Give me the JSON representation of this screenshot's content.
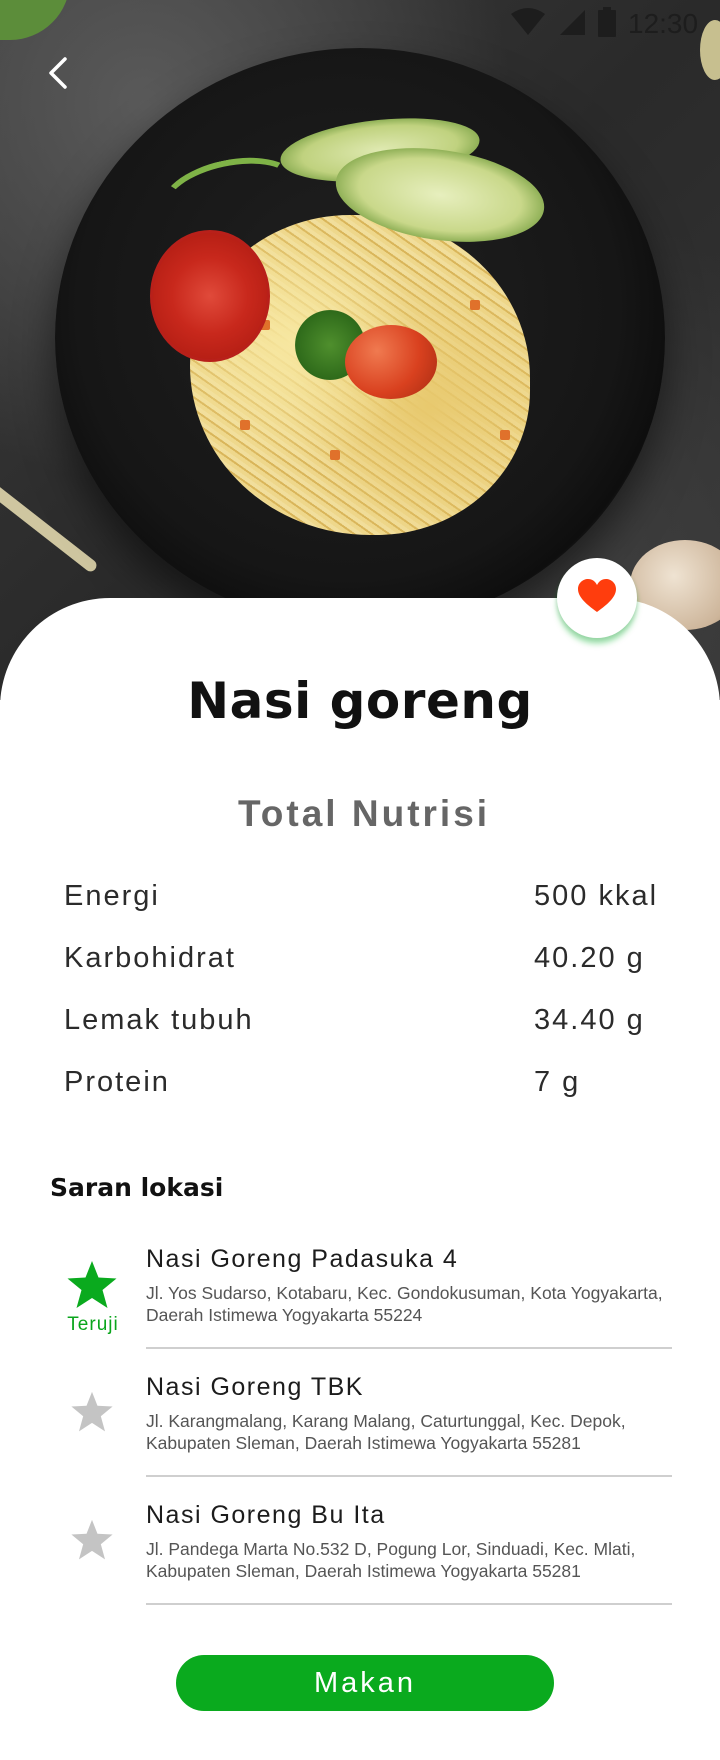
{
  "status_bar": {
    "time": "12:30"
  },
  "header": {
    "back_icon": "chevron-left-icon"
  },
  "hero": {
    "image": "nasi-goreng-photo"
  },
  "favorite": {
    "icon": "heart-icon",
    "color": "#ff3d0d"
  },
  "dish": {
    "title": "Nasi goreng"
  },
  "nutrition": {
    "heading": "Total Nutrisi",
    "rows": [
      {
        "label": "Energi",
        "value": "500 kkal"
      },
      {
        "label": "Karbohidrat",
        "value": "40.20 g"
      },
      {
        "label": "Lemak tubuh",
        "value": "34.40 g"
      },
      {
        "label": "Protein",
        "value": "7 g"
      }
    ]
  },
  "locations": {
    "title": "Saran lokasi",
    "items": [
      {
        "name": "Nasi Goreng Padasuka 4",
        "address_line1": "Jl. Yos Sudarso, Kotabaru, Kec. Gondokusuman, Kota Yogyakarta,",
        "address_line2": "Daerah Istimewa Yogyakarta 55224",
        "badge": "Teruji",
        "star_color": "#0aaa1e"
      },
      {
        "name": "Nasi Goreng TBK",
        "address_line1": "Jl. Karangmalang, Karang Malang, Caturtunggal, Kec. Depok,",
        "address_line2": "Kabupaten Sleman, Daerah Istimewa Yogyakarta 55281",
        "badge": "",
        "star_color": "#c4c4c4"
      },
      {
        "name": "Nasi Goreng Bu Ita",
        "address_line1": "Jl. Pandega Marta No.532 D, Pogung Lor, Sinduadi, Kec. Mlati,",
        "address_line2": "Kabupaten Sleman, Daerah Istimewa Yogyakarta 55281",
        "badge": "",
        "star_color": "#c4c4c4"
      }
    ]
  },
  "action": {
    "label": "Makan",
    "color": "#0aaa1e"
  }
}
